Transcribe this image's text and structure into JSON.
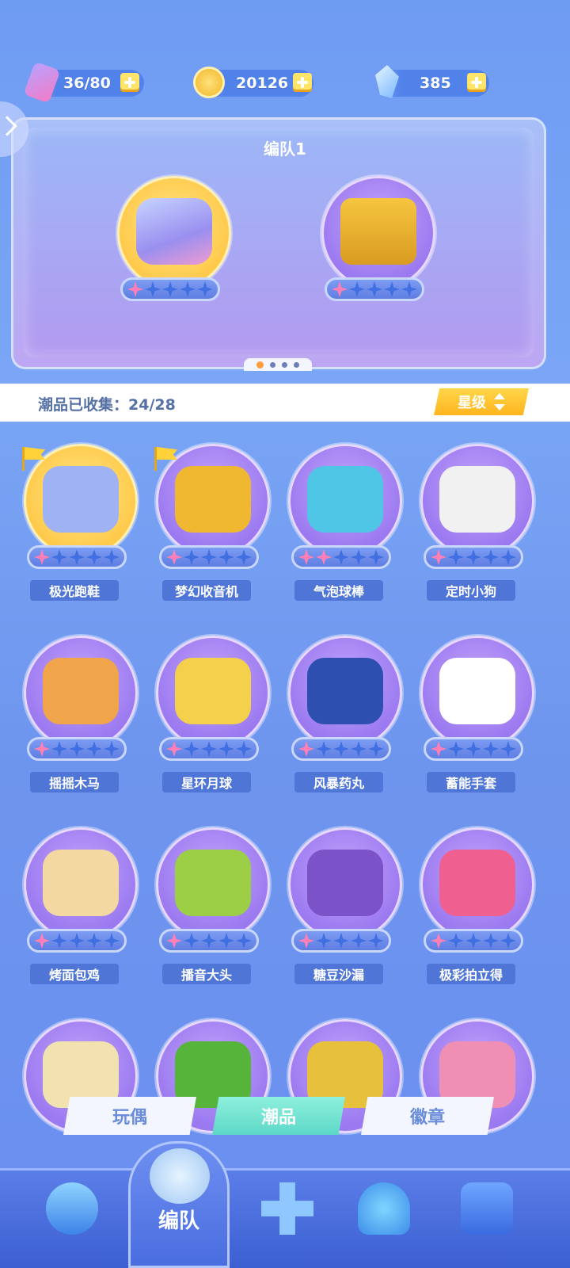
{
  "resources": {
    "stamina": "36/80",
    "coins": "20126",
    "gems": "385"
  },
  "formation": {
    "title": "编队1",
    "slots": [
      {
        "name": "极光跑鞋",
        "stars": 1,
        "max_stars": 5,
        "bg": "gold"
      },
      {
        "name": "梦幻收音机",
        "stars": 1,
        "max_stars": 5,
        "bg": "purple"
      }
    ],
    "page_index": 1,
    "page_count": 4
  },
  "collection": {
    "label": "潮品已收集：24/28",
    "sort_label": "星级"
  },
  "items": [
    {
      "name": "极光跑鞋",
      "stars": 1,
      "flag": true,
      "bg": "gold",
      "color": "#9fb2f4"
    },
    {
      "name": "梦幻收音机",
      "stars": 1,
      "flag": true,
      "bg": "purple",
      "color": "#f0b731"
    },
    {
      "name": "气泡球棒",
      "stars": 2,
      "flag": false,
      "bg": "purple",
      "color": "#4fc6e6"
    },
    {
      "name": "定时小狗",
      "stars": 1,
      "flag": false,
      "bg": "purple",
      "color": "#f1f1f1"
    },
    {
      "name": "摇摇木马",
      "stars": 1,
      "flag": false,
      "bg": "purple",
      "color": "#f1a54a"
    },
    {
      "name": "星环月球",
      "stars": 1,
      "flag": false,
      "bg": "purple",
      "color": "#f5d04a"
    },
    {
      "name": "风暴药丸",
      "stars": 1,
      "flag": false,
      "bg": "purple",
      "color": "#2c4fb0"
    },
    {
      "name": "蓄能手套",
      "stars": 1,
      "flag": false,
      "bg": "purple",
      "color": "#ffffff"
    },
    {
      "name": "烤面包鸡",
      "stars": 1,
      "flag": false,
      "bg": "purple",
      "color": "#f3d8a2"
    },
    {
      "name": "播音大头",
      "stars": 1,
      "flag": false,
      "bg": "purple",
      "color": "#9ccf46"
    },
    {
      "name": "糖豆沙漏",
      "stars": 1,
      "flag": false,
      "bg": "purple",
      "color": "#7b52c8"
    },
    {
      "name": "极彩拍立得",
      "stars": 1,
      "flag": false,
      "bg": "purple",
      "color": "#ef5f8f"
    },
    {
      "name": "",
      "stars": 0,
      "flag": false,
      "bg": "purple",
      "color": "#f2e2b0"
    },
    {
      "name": "",
      "stars": 0,
      "flag": false,
      "bg": "purple",
      "color": "#56b43a"
    },
    {
      "name": "",
      "stars": 0,
      "flag": false,
      "bg": "purple",
      "color": "#e7c13c"
    },
    {
      "name": "",
      "stars": 0,
      "flag": false,
      "bg": "purple",
      "color": "#f08fb4"
    }
  ],
  "tabs": [
    {
      "label": "玩偶",
      "active": false
    },
    {
      "label": "潮品",
      "active": true
    },
    {
      "label": "徽章",
      "active": false
    }
  ],
  "nav": {
    "active_label": "编队",
    "items": [
      "home-icon",
      "formation-icon",
      "gamepad-icon",
      "trophy-icon",
      "mystery-box-icon"
    ]
  }
}
